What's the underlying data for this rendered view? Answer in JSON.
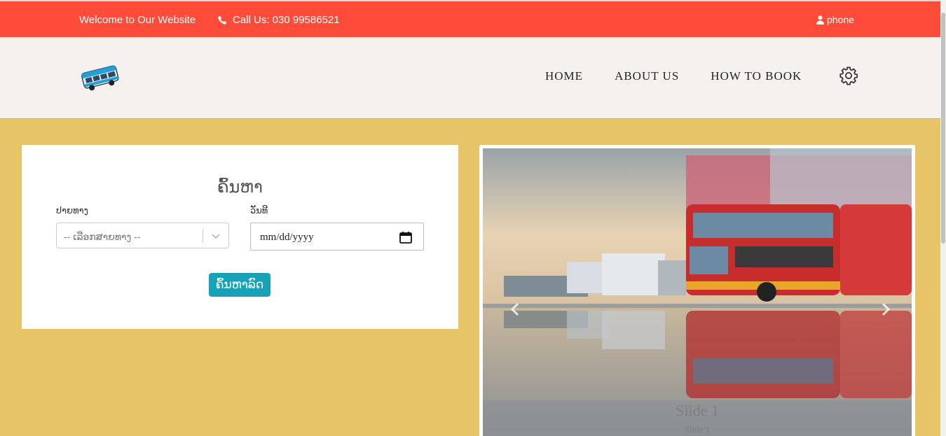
{
  "topbar": {
    "welcome": "Welcome to Our Website",
    "call": "Call Us: 030 99586521",
    "account": "phone"
  },
  "nav": {
    "items": [
      "HOME",
      "ABOUT US",
      "HOW TO BOOK"
    ]
  },
  "search": {
    "title": "ຄົ້ນຫາ",
    "destination_label": "ປາຍທາງ",
    "destination_placeholder": "-- ເລືອກສາຍທາງ --",
    "date_label": "ວັນທີ",
    "date_value": "mm/dd/yyyy",
    "button": "ຄົ້ນຫາລົດ"
  },
  "carousel": {
    "caption_title": "Slide 1",
    "caption_sub": "Slide 1"
  },
  "icons": {
    "phone": "phone-icon",
    "user": "user-icon",
    "settings": "gear-icon",
    "logo": "bus-logo-icon"
  },
  "colors": {
    "topbar": "#ff4b3a",
    "main_bg": "#e8c468",
    "button": "#17a2b8"
  }
}
